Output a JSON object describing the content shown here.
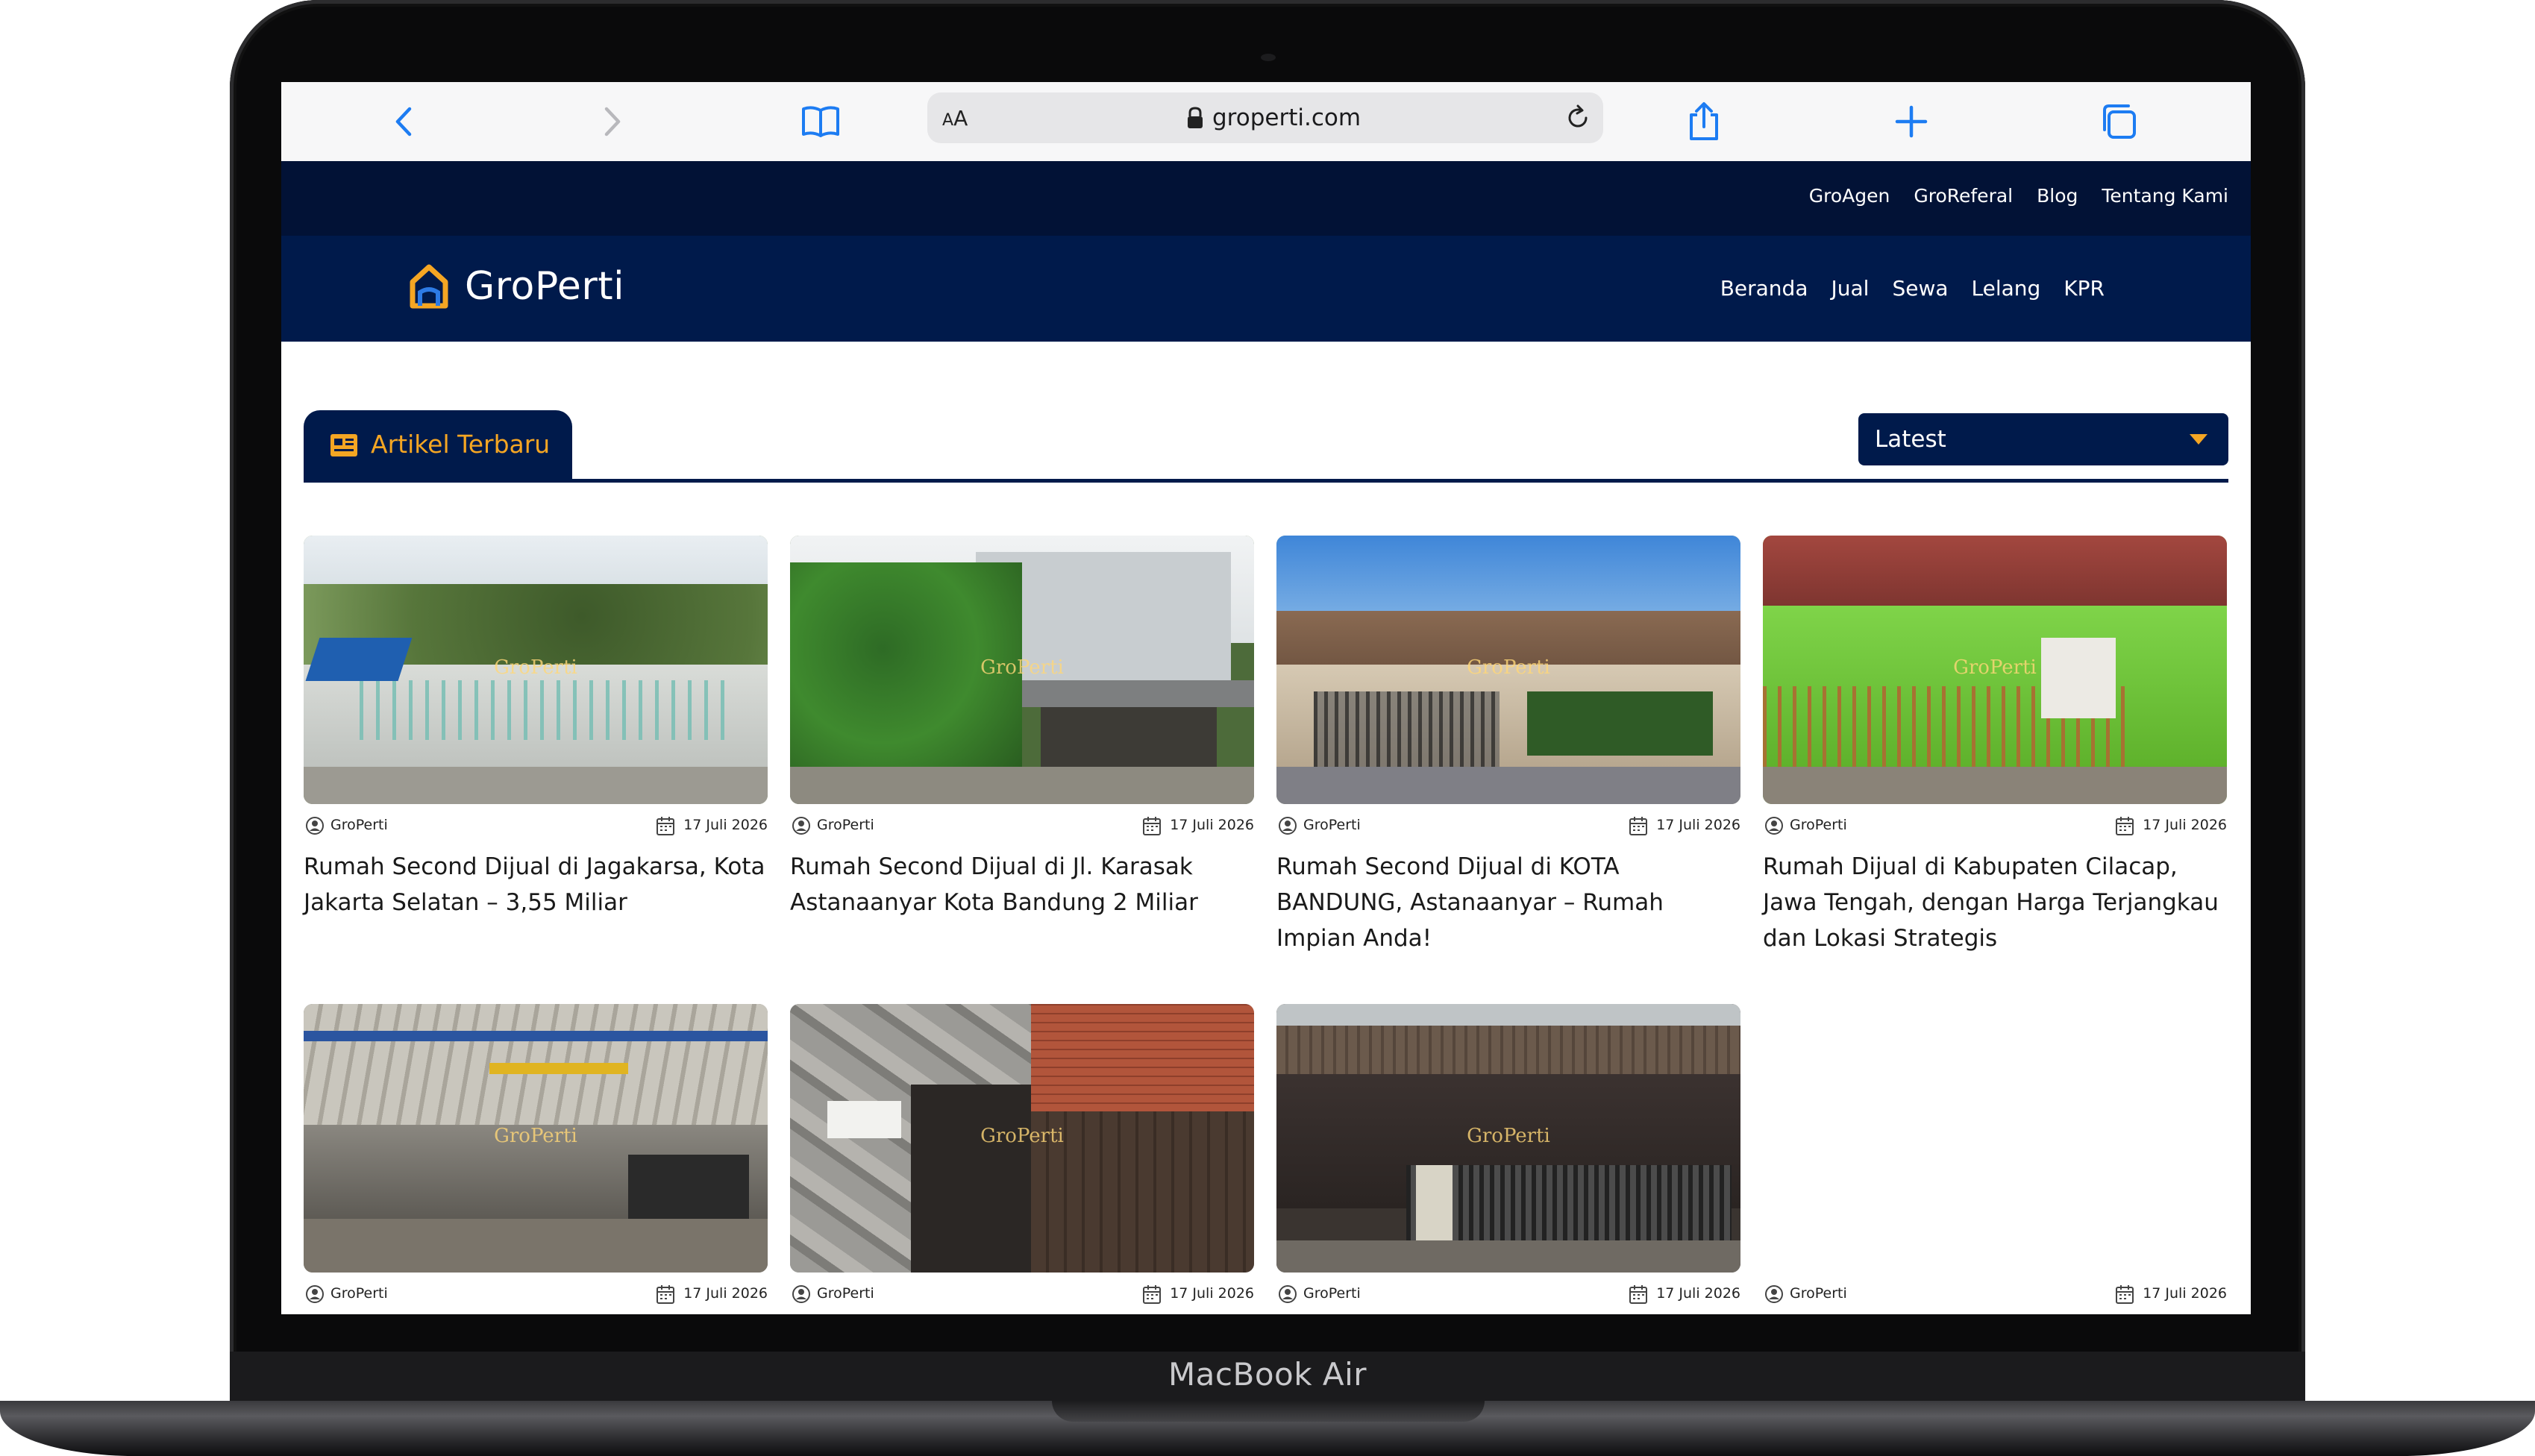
{
  "device": {
    "label": "MacBook Air"
  },
  "browser": {
    "aa_label": "A",
    "aa_small": "A",
    "url": "groperti.com"
  },
  "site": {
    "brand": "GroPerti",
    "utility_links": [
      "GroAgen",
      "GroReferal",
      "Blog",
      "Tentang Kami"
    ],
    "main_links": [
      "Beranda",
      "Jual",
      "Sewa",
      "Lelang",
      "KPR"
    ],
    "colors": {
      "navy_top": "#021236",
      "navy": "#001a4b",
      "accent": "#f5a623"
    }
  },
  "content": {
    "tab_label": "Artikel Terbaru",
    "sort": {
      "selected": "Latest"
    },
    "watermark": "GroPerti",
    "cards": [
      {
        "author": "GroPerti",
        "date": "17 Juli 2026",
        "title": "Rumah Second Dijual di Jagakarsa, Kota Jakarta Selatan – 3,55 Miliar"
      },
      {
        "author": "GroPerti",
        "date": "17 Juli 2026",
        "title": "Rumah Second Dijual di Jl. Karasak Astanaanyar Kota Bandung 2 Miliar"
      },
      {
        "author": "GroPerti",
        "date": "17 Juli 2026",
        "title": "Rumah Second Dijual di KOTA BANDUNG, Astanaanyar – Rumah Impian Anda!"
      },
      {
        "author": "GroPerti",
        "date": "17 Juli 2026",
        "title": "Rumah Dijual di Kabupaten Cilacap, Jawa Tengah, dengan Harga Terjangkau dan Lokasi Strategis"
      },
      {
        "author": "GroPerti",
        "date": "17 Juli 2026",
        "title": ""
      },
      {
        "author": "GroPerti",
        "date": "17 Juli 2026",
        "title": ""
      },
      {
        "author": "GroPerti",
        "date": "17 Juli 2026",
        "title": ""
      },
      {
        "author": "GroPerti",
        "date": "17 Juli 2026",
        "title": ""
      }
    ]
  }
}
